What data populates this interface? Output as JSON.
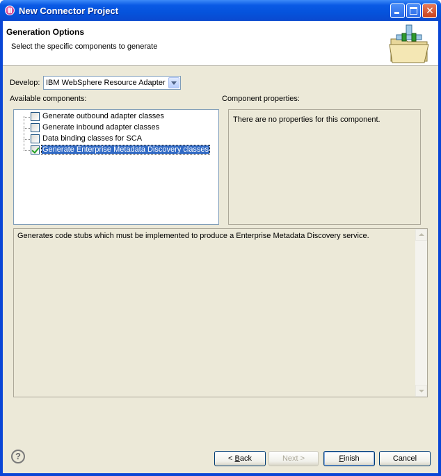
{
  "window": {
    "title": "New Connector Project"
  },
  "header": {
    "title": "Generation Options",
    "description": "Select the specific components to generate"
  },
  "develop": {
    "label": "Develop:",
    "selected": "IBM WebSphere Resource Adapter"
  },
  "available": {
    "label": "Available components:",
    "items": [
      {
        "label": "Generate outbound adapter classes",
        "checked": false,
        "selected": false
      },
      {
        "label": "Generate inbound adapter classes",
        "checked": false,
        "selected": false
      },
      {
        "label": "Data binding classes for SCA",
        "checked": false,
        "selected": false
      },
      {
        "label": "Generate Enterprise Metadata Discovery classes",
        "checked": true,
        "selected": true
      }
    ]
  },
  "properties": {
    "label": "Component properties:",
    "message": "There are no properties for this component."
  },
  "description": {
    "text": "Generates code stubs which must be implemented to produce a Enterprise Metadata Discovery service."
  },
  "buttons": {
    "help": "?",
    "back_prefix": "< ",
    "back_key": "B",
    "back_rest": "ack",
    "next": "Next >",
    "finish_key": "F",
    "finish_rest": "inish",
    "cancel": "Cancel"
  },
  "colors": {
    "titlebar": "#0553dc",
    "dialog_bg": "#ece9d8",
    "selection": "#316ac5"
  }
}
